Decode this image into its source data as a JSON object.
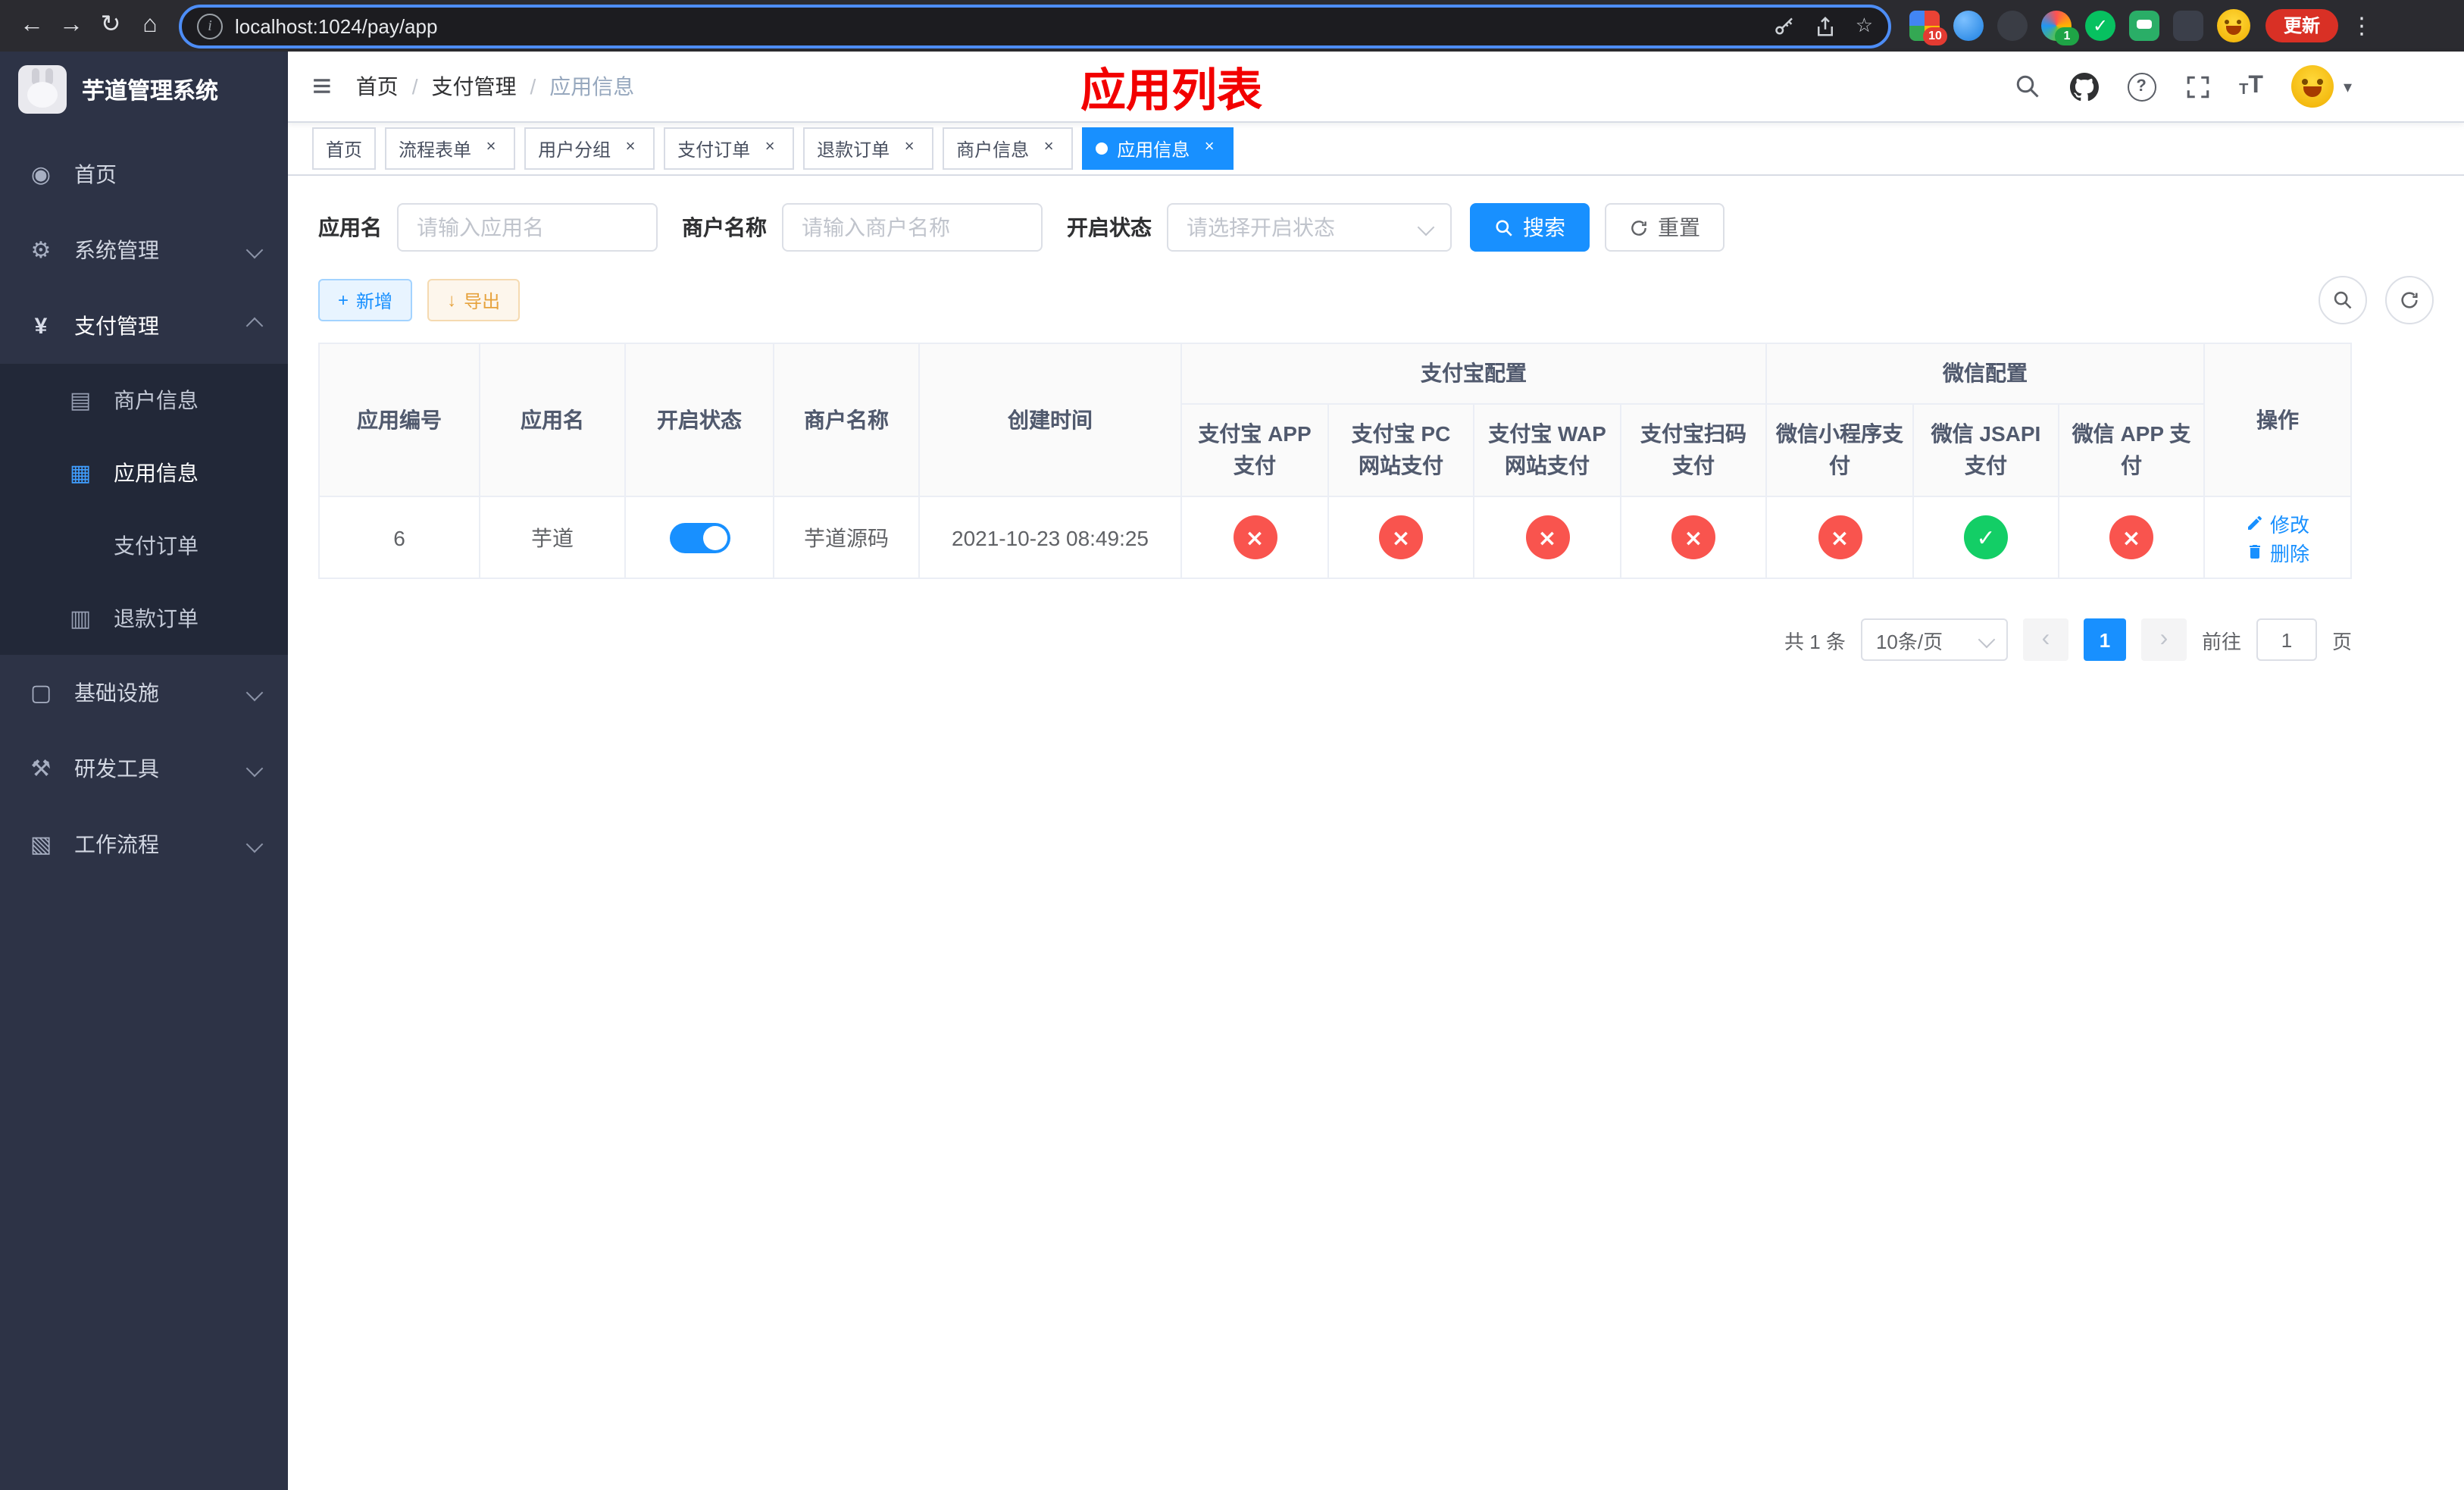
{
  "browser": {
    "url": "localhost:1024/pay/app",
    "update_label": "更新",
    "ext_badge_grid": "10",
    "ext_badge_rainbow": "1"
  },
  "icons": {
    "back": "←",
    "forward": "→",
    "reload": "↻",
    "home": "⌂",
    "info": "i",
    "star": "☆",
    "menu_dots": "⋮",
    "hamburger": "≡",
    "check": "✓",
    "cross": "×",
    "question": "?",
    "caret_down": "▾",
    "prev": "‹",
    "next": "›",
    "plus": "+",
    "download": "↓",
    "wechat_check": "✓"
  },
  "sidebar": {
    "title": "芋道管理系统",
    "icons": {
      "home": "◉",
      "system": "⚙",
      "pay": "¥",
      "merchant": "▤",
      "app": "▦",
      "order": "◎",
      "refund": "▥",
      "infra": "▢",
      "devtool": "⚒",
      "workflow": "▧"
    },
    "items": [
      {
        "label": "首页"
      },
      {
        "label": "系统管理"
      },
      {
        "label": "支付管理"
      },
      {
        "label": "基础设施"
      },
      {
        "label": "研发工具"
      },
      {
        "label": "工作流程"
      }
    ],
    "pay_children": [
      {
        "label": "商户信息"
      },
      {
        "label": "应用信息"
      },
      {
        "label": "支付订单"
      },
      {
        "label": "退款订单"
      }
    ]
  },
  "header": {
    "breadcrumb": [
      "首页",
      "支付管理",
      "应用信息"
    ],
    "page_title": "应用列表"
  },
  "tabs": [
    {
      "label": "首页"
    },
    {
      "label": "流程表单"
    },
    {
      "label": "用户分组"
    },
    {
      "label": "支付订单"
    },
    {
      "label": "退款订单"
    },
    {
      "label": "商户信息"
    },
    {
      "label": "应用信息"
    }
  ],
  "filters": {
    "app_name_label": "应用名",
    "app_name_placeholder": "请输入应用名",
    "merchant_name_label": "商户名称",
    "merchant_name_placeholder": "请输入商户名称",
    "status_label": "开启状态",
    "status_placeholder": "请选择开启状态",
    "search_label": "搜索",
    "reset_label": "重置"
  },
  "toolbar": {
    "add_label": "新增",
    "export_label": "导出"
  },
  "table": {
    "headers": {
      "app_id": "应用编号",
      "app_name": "应用名",
      "status": "开启状态",
      "merchant_name": "商户名称",
      "create_time": "创建时间",
      "alipay_group": "支付宝配置",
      "wechat_group": "微信配置",
      "alipay_app": "支付宝 APP 支付",
      "alipay_pc": "支付宝 PC 网站支付",
      "alipay_wap": "支付宝 WAP 网站支付",
      "alipay_qr": "支付宝扫码支付",
      "wx_lite": "微信小程序支付",
      "wx_jsapi": "微信 JSAPI 支付",
      "wx_app": "微信 APP 支付",
      "actions": "操作"
    },
    "rows": [
      {
        "app_id": "6",
        "app_name": "芋道",
        "status_on": true,
        "merchant_name": "芋道源码",
        "create_time": "2021-10-23 08:49:25",
        "alipay_app": false,
        "alipay_pc": false,
        "alipay_wap": false,
        "alipay_qr": false,
        "wx_lite": false,
        "wx_jsapi": true,
        "wx_app": false,
        "edit_label": "修改",
        "delete_label": "删除"
      }
    ]
  },
  "pagination": {
    "total_label": "共 1 条",
    "page_size": "10条/页",
    "current_page": "1",
    "goto_label": "前往",
    "goto_value": "1",
    "page_suffix": "页"
  },
  "colors": {
    "accent": "#1890ff",
    "danger": "#f9544e",
    "success": "#13ce66",
    "warning": "#e6a23c",
    "sidebar_bg": "#2d3346",
    "title_red": "#f20000"
  }
}
